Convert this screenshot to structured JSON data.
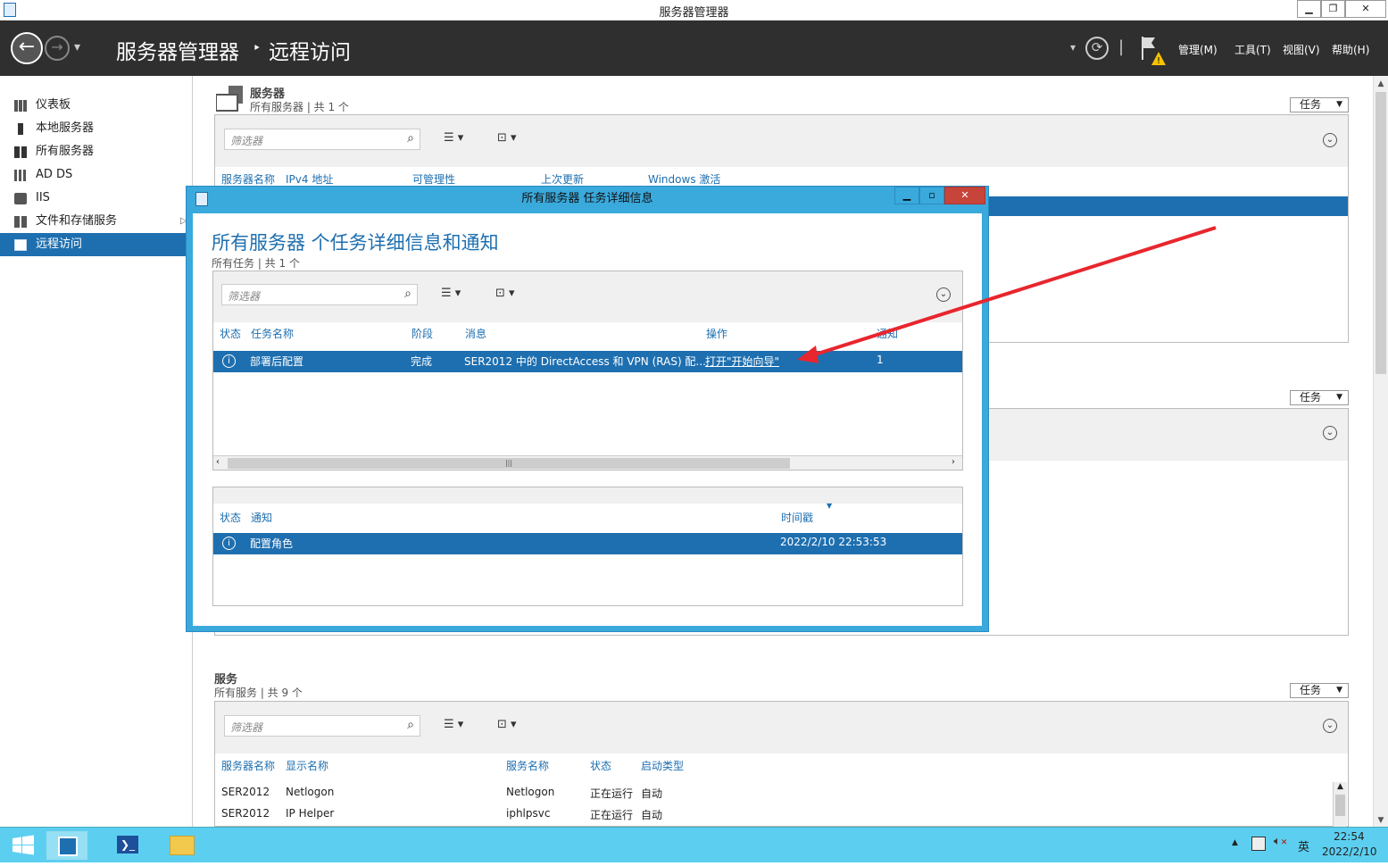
{
  "window": {
    "title": "服务器管理器",
    "min": "▁",
    "max": "❐",
    "close": "✕"
  },
  "header": {
    "breadcrumb_root": "服务器管理器",
    "breadcrumb_sep": "‣",
    "breadcrumb_current": "远程访问",
    "menus": [
      "管理(M)",
      "工具(T)",
      "视图(V)",
      "帮助(H)"
    ],
    "back_icon": "←",
    "forward_icon": "→",
    "dropdown_icon": "▾",
    "refresh_icon": "⟳",
    "sep": "|"
  },
  "sidebar": {
    "items": [
      {
        "label": "仪表板"
      },
      {
        "label": "本地服务器"
      },
      {
        "label": "所有服务器"
      },
      {
        "label": "AD DS"
      },
      {
        "label": "IIS"
      },
      {
        "label": "文件和存储服务"
      },
      {
        "label": "远程访问"
      }
    ],
    "expand_arrow": "▷"
  },
  "servers_panel": {
    "title": "服务器",
    "subtitle": "所有服务器 | 共 1 个",
    "tasks_label": "任务",
    "filter_placeholder": "筛选器",
    "columns": [
      "服务器名称",
      "IPv4 地址",
      "可管理性",
      "上次更新",
      "Windows 激活"
    ]
  },
  "middle_panel": {
    "tasks_label": "任务"
  },
  "services_panel": {
    "title": "服务",
    "subtitle": "所有服务 | 共 9 个",
    "tasks_label": "任务",
    "filter_placeholder": "筛选器",
    "columns": [
      "服务器名称",
      "显示名称",
      "服务名称",
      "状态",
      "启动类型"
    ],
    "rows": [
      {
        "server": "SER2012",
        "display": "Netlogon",
        "service": "Netlogon",
        "status": "正在运行",
        "startup": "自动"
      },
      {
        "server": "SER2012",
        "display": "IP Helper",
        "service": "iphlpsvc",
        "status": "正在运行",
        "startup": "自动"
      }
    ]
  },
  "dialog": {
    "title": "所有服务器 任务详细信息",
    "heading": "所有服务器 个任务详细信息和通知",
    "subtitle": "所有任务 | 共 1 个",
    "filter_placeholder": "筛选器",
    "task_columns": [
      "状态",
      "任务名称",
      "阶段",
      "消息",
      "操作",
      "通知"
    ],
    "task_row": {
      "status_icon": "i",
      "name": "部署后配置",
      "stage": "完成",
      "message": "SER2012 中的 DirectAccess 和 VPN (RAS) 配...",
      "action": "打开\"开始向导\"",
      "notify": "1"
    },
    "notif_columns": [
      "状态",
      "通知",
      "时间戳"
    ],
    "notif_row": {
      "status_icon": "i",
      "notice": "配置角色",
      "timestamp": "2022/2/10 22:53:53"
    },
    "scroll_handle": "|||"
  },
  "taskbar": {
    "time": "22:54",
    "date": "2022/2/10",
    "ime": "英"
  },
  "colors": {
    "accent": "#1e6fb0",
    "header_bg": "#2f2f2f",
    "dialog_frame": "#3aa9dc",
    "taskbar": "#5ccff0",
    "arrow": "#e8262e"
  }
}
